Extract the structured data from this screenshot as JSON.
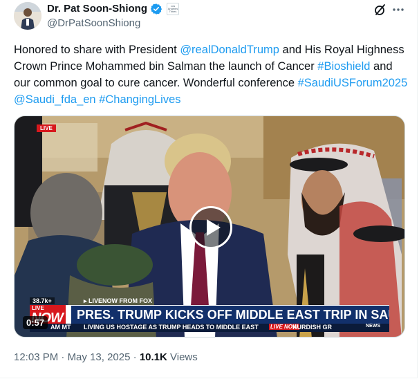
{
  "author": {
    "display_name": "Dr. Pat Soon-Shiong",
    "handle": "@DrPatSoonShiong",
    "affiliation_badge_text": "Los Angeles Times"
  },
  "tweet": {
    "text_parts": {
      "p1": "Honored to share with President ",
      "m1": "@realDonaldTrump",
      "p2": " and His Royal Highness Crown Prince Mohammed bin Salman the launch of Cancer ",
      "h1": "#Bioshield",
      "p3": " and our common goal to cure cancer. Wonderful conference ",
      "h2": "#SaudiUSForum2025",
      "p4": " ",
      "m2": "@Saudi_fda_en",
      "p5": " ",
      "h3": "#ChangingLives"
    }
  },
  "video": {
    "duration": "0:57",
    "overlay": {
      "live_tag": "LIVE",
      "viewers": "38.7k+",
      "livenow_from": "▸ LIVENOW FROM FOX",
      "badge_live": "LIVE",
      "badge_now": "NOW",
      "headline": "PRES. TRUMP KICKS OFF MIDDLE EAST TRIP IN SAUDI ARABIA",
      "crawl_time": "AM MT",
      "crawl_text": "LIVING US HOSTAGE AS TRUMP HEADS TO MIDDLE EAST",
      "crawl_logo": "LIVE NOW",
      "crawl_text2": "KURDISH GR",
      "news_tag": "NEWS"
    }
  },
  "meta": {
    "time": "12:03 PM",
    "sep1": " · ",
    "date": "May 13, 2025",
    "sep2": " · ",
    "views_count": "10.1K",
    "views_label": " Views"
  },
  "colors": {
    "link": "#1d9bf0",
    "text": "#0f1419",
    "secondary": "#536471",
    "verified": "#1d9bf0",
    "fox_red": "#d7181d",
    "fox_blue": "#12306b"
  },
  "icons": {
    "verified": "verified-badge-icon",
    "grok": "grok-icon",
    "more": "more-horizontal-icon",
    "play": "play-icon"
  }
}
